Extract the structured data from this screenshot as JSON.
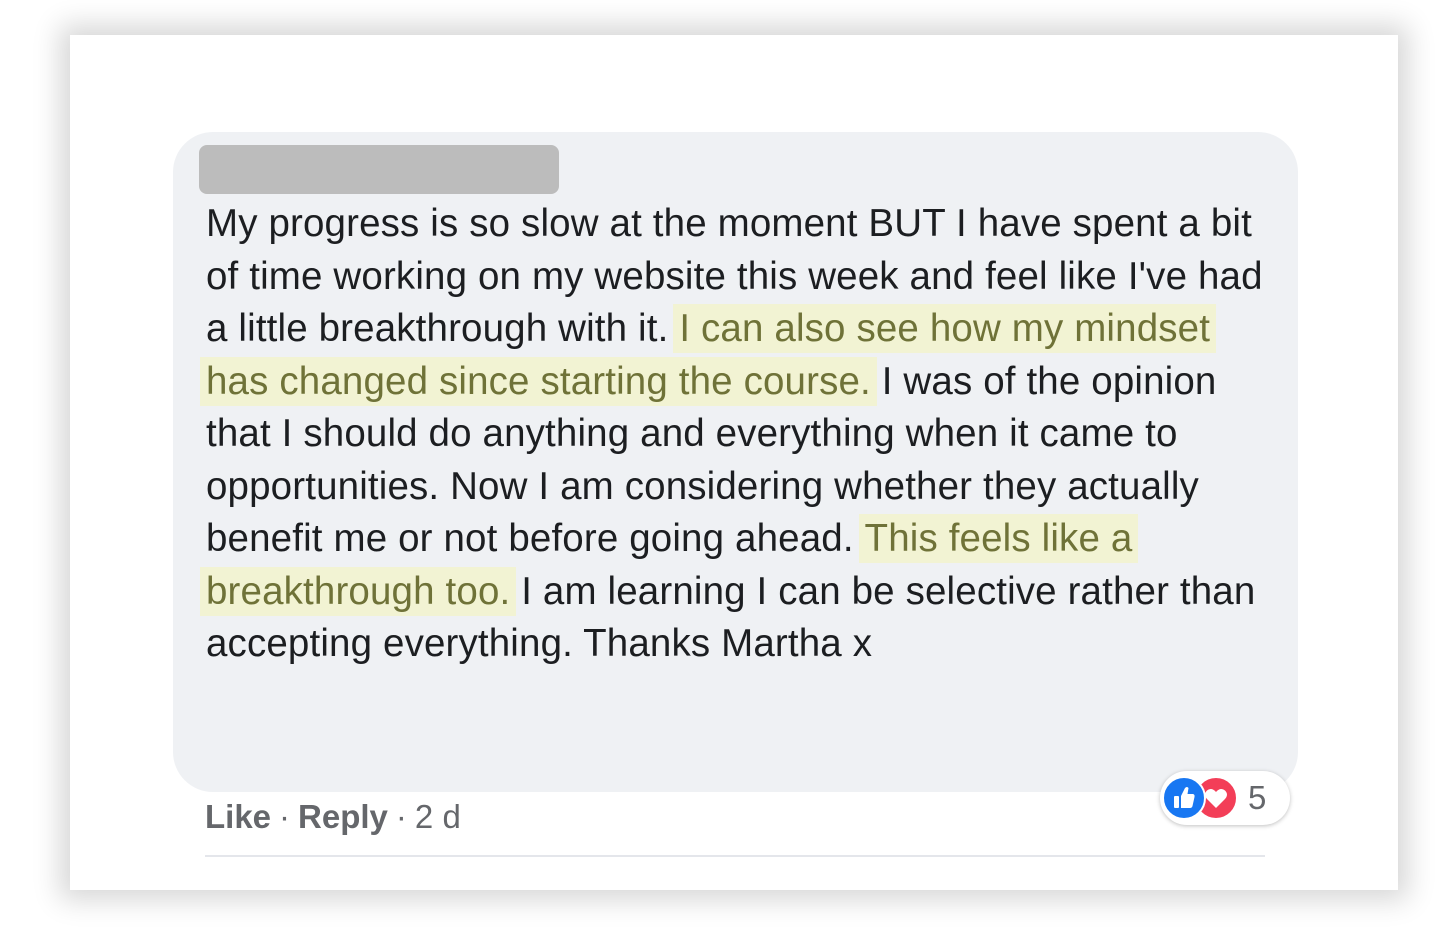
{
  "comment": {
    "author_name": "",
    "segments": [
      {
        "text": "My progress is so slow at the moment BUT I have spent a bit of time working on my website this week and feel like I've had a little breakthrough with it. ",
        "highlighted": false
      },
      {
        "text": "I can also see how my mindset has changed since starting the course.",
        "highlighted": true
      },
      {
        "text": " I was of the opinion that I should do anything and everything when it came to opportunities. Now I am considering whether they actually benefit me or not before going ahead. ",
        "highlighted": false
      },
      {
        "text": "This feels like a breakthrough too.",
        "highlighted": true
      },
      {
        "text": " I am learning I can be selective rather than accepting everything. Thanks Martha x",
        "highlighted": false
      }
    ],
    "highlight_colors": {
      "background": "#f2f3d3",
      "text": "#6f7238"
    }
  },
  "actions": {
    "like_label": "Like",
    "separator": "·",
    "reply_label": "Reply",
    "timestamp": "2 d"
  },
  "reactions": {
    "icons": [
      "like-icon",
      "love-icon"
    ],
    "count": "5",
    "like_color": "#1877f2",
    "love_color": "#f33e58"
  }
}
